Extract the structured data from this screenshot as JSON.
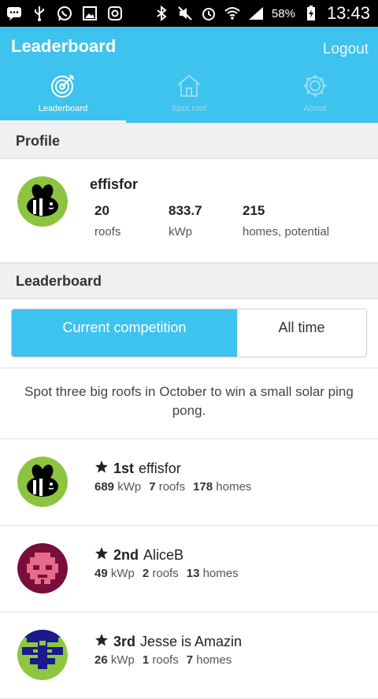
{
  "status_bar": {
    "battery_percent": "58%",
    "time": "13:43"
  },
  "app_bar": {
    "title": "Leaderboard",
    "logout_label": "Logout"
  },
  "tabs": [
    {
      "label": "Leaderboard",
      "icon": "target-icon",
      "active": true
    },
    {
      "label": "Spot roof",
      "icon": "house-icon",
      "active": false
    },
    {
      "label": "About",
      "icon": "gear-icon",
      "active": false
    }
  ],
  "profile": {
    "header": "Profile",
    "username": "effisfor",
    "stats": [
      {
        "value": "20",
        "label": "roofs"
      },
      {
        "value": "833.7",
        "label": "kWp"
      },
      {
        "value": "215",
        "label": "homes, potential"
      }
    ]
  },
  "leaderboard": {
    "header": "Leaderboard",
    "segments": {
      "current": "Current competition",
      "all_time": "All time"
    },
    "description": "Spot three big roofs in October to win a small solar ping pong.",
    "entries": [
      {
        "rank": "1st",
        "name": "effisfor",
        "kwp": "689",
        "kwp_unit": "kWp",
        "roofs": "7",
        "roofs_unit": "roofs",
        "homes": "178",
        "homes_unit": "homes"
      },
      {
        "rank": "2nd",
        "name": "AliceB",
        "kwp": "49",
        "kwp_unit": "kWp",
        "roofs": "2",
        "roofs_unit": "roofs",
        "homes": "13",
        "homes_unit": "homes"
      },
      {
        "rank": "3rd",
        "name": "Jesse is Amazin",
        "kwp": "26",
        "kwp_unit": "kWp",
        "roofs": "1",
        "roofs_unit": "roofs",
        "homes": "7",
        "homes_unit": "homes"
      }
    ]
  },
  "colors": {
    "accent": "#3ec2ee",
    "bee_avatar_bg": "#8cc43f"
  }
}
